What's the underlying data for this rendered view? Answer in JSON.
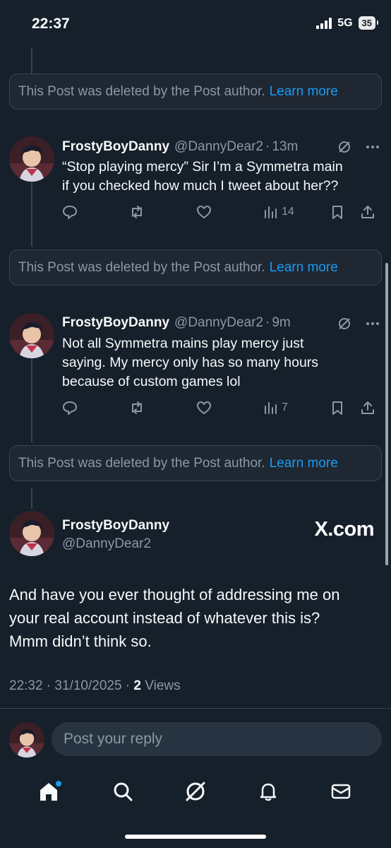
{
  "status_bar": {
    "time": "22:37",
    "network": "5G",
    "battery": "35"
  },
  "deleted_notice": {
    "text": "This Post was deleted by the Post author.",
    "link": "Learn more"
  },
  "posts": [
    {
      "name": "FrostyBoyDanny",
      "handle": "@DannyDear2",
      "time": "13m",
      "text_lines": [
        "“Stop playing mercy” Sir I’m a Symmetra main",
        "if you checked how much I tweet about her??"
      ],
      "views": "14"
    },
    {
      "name": "FrostyBoyDanny",
      "handle": "@DannyDear2",
      "time": "9m",
      "text_lines": [
        "Not all Symmetra mains play mercy just",
        "saying. My mercy only has so many hours",
        "because of custom games lol"
      ],
      "views": "7"
    }
  ],
  "main_post": {
    "name": "FrostyBoyDanny",
    "handle": "@DannyDear2",
    "watermark": "X.com",
    "text_lines": [
      "And have you ever thought of addressing me on",
      "your real account instead of whatever this is?",
      "Mmm didn’t think so."
    ],
    "timestamp": "22:32 · 31/10/2025 ·",
    "views_count": "2",
    "views_label": "Views"
  },
  "reply": {
    "placeholder": "Post your reply"
  },
  "nav": [
    "home-icon",
    "search-icon",
    "grok-icon",
    "bell-icon",
    "mail-icon"
  ],
  "colors": {
    "background": "#15202b",
    "accent": "#1d9bf0",
    "muted": "#8b98a5"
  }
}
